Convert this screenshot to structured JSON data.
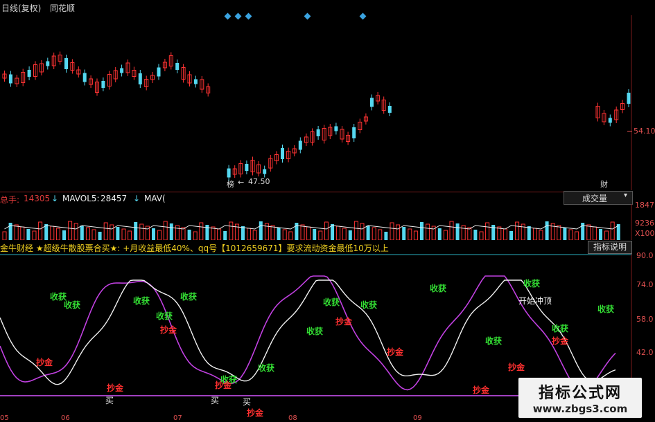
{
  "topbar": {
    "period": "日线(复权)",
    "app": "同花顺"
  },
  "price_axis": {
    "level": "54.10",
    "low_marker": "47.50",
    "low_tag": "榜",
    "fin_tag": "财"
  },
  "volume": {
    "total_label": "总手:",
    "total_value": "14305",
    "mavol5_label": "MAVOL5:",
    "mavol5_value": "28457",
    "mavol_next": "MAV(",
    "select_label": "成交量",
    "axis": [
      "1847",
      "9236",
      "X100"
    ]
  },
  "indicator": {
    "banner": "金牛财经 ★超级牛散股票合买★: +月收益最低40%、qq号【1012659671】要求流动资金最低10万以上",
    "explain_button": "指标说明",
    "axis": [
      "90.0",
      "74.0",
      "58.0",
      "42.0"
    ]
  },
  "signals": {
    "harvest": "收获",
    "dip": "抄金",
    "buy": "买",
    "start": "开始冲顶"
  },
  "bottom_axis": [
    "05",
    "06",
    "07",
    "08",
    "09"
  ],
  "watermark": {
    "title": "指标公式网",
    "url": "www.zbgs3.com"
  },
  "colors": {
    "up": "#ff3333",
    "down": "#55d8f0",
    "white_line": "#f0f0f0",
    "purple_line": "#c040e0",
    "baseline": "#a040c0"
  }
}
